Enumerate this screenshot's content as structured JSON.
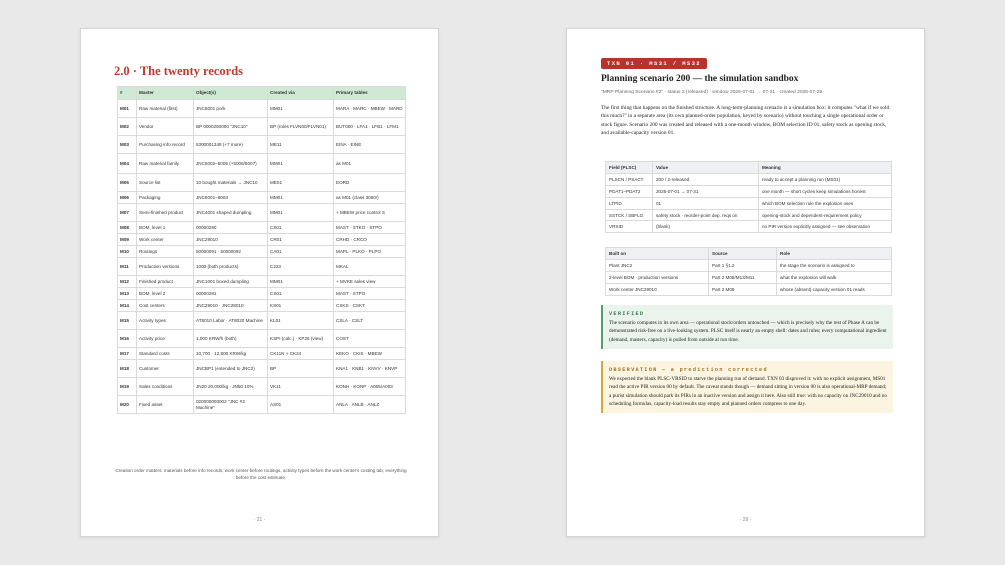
{
  "left_page": {
    "heading": "2.0 · The twenty records",
    "table": {
      "headers": [
        "#",
        "Master",
        "Object(s)",
        "Created via",
        "Primary tables"
      ],
      "rows": [
        [
          "M01",
          "Raw material (first)",
          "JNC5001 pork",
          "MM01",
          "MARA · MARC · MBEW · MARD"
        ],
        [
          "M02",
          "Vendor",
          "BP 0000260000 \"JNC10\"",
          "BP (roles FLVN00/FLVN01)",
          "BUT000 · LFA1 · LFB1 · LFM1"
        ],
        [
          "M03",
          "Purchasing info record",
          "5300001348 (+7 more)",
          "ME11",
          "EINA · EINE"
        ],
        [
          "M04",
          "Raw material family",
          "JNC5002–5005 (+5006/5007)",
          "MM01",
          "as M01"
        ],
        [
          "M05",
          "Source list",
          "10 bought materials → JNC10",
          "ME01",
          "EORD"
        ],
        [
          "M06",
          "Packaging",
          "JNC6001–6003",
          "MM01",
          "as M01 (class 3050!)"
        ],
        [
          "M07",
          "Semi-finished product",
          "JNC4001 shaped dumpling",
          "MM01",
          "+ MBEW price control S"
        ],
        [
          "M08",
          "BOM, level 1",
          "00000280",
          "CS01",
          "MAST · STKO · STPO"
        ],
        [
          "M09",
          "Work center",
          "JNC29010",
          "CR01",
          "CRHD · CRCO"
        ],
        [
          "M10",
          "Routings",
          "50000091 · 50000092",
          "CA01",
          "MAPL · PLKO · PLPO"
        ],
        [
          "M11",
          "Production versions",
          "1000 (both products)",
          "C223",
          "MKAL"
        ],
        [
          "M12",
          "Finished product",
          "JNC1001 boxed dumpling",
          "MM01",
          "+ MVKE sales view"
        ],
        [
          "M13",
          "BOM, level 2",
          "00000281",
          "CS01",
          "MAST · STPO"
        ],
        [
          "M14",
          "Cost centers",
          "JNC29010 · JNC28010",
          "KS01",
          "CSKS · CSKT"
        ],
        [
          "M15",
          "Activity types",
          "AT8010 Labor · AT8020 Machine",
          "KL01",
          "CSLA · CSLT"
        ],
        [
          "M16",
          "Activity price",
          "1,000 KRW/h (both)",
          "KSPI (calc.) · KP26 (view)",
          "COST"
        ],
        [
          "M17",
          "Standard costs",
          "10,700 · 12,800 KRW/kg",
          "CK11N + CK24",
          "KEKO · CKIS · MBEW"
        ],
        [
          "M18",
          "Customer",
          "JNCBP1 (extended to JNC2)",
          "BP",
          "KNA1 · KNB1 · KNVV · KNVP"
        ],
        [
          "M19",
          "Sales conditions",
          "JN20 20,000/kg · JN50 10%",
          "VK11",
          "KONH · KONP · A005/A003"
        ],
        [
          "M20",
          "Fixed asset",
          "020000000002 \"JNC #2 Machine\"",
          "AS01",
          "ANLA · ANLB · ANLZ"
        ]
      ]
    },
    "caption": "Creation order matters: materials before info records, work center before routings, activity types before the work center's costing tab, everything before the cost estimate.",
    "page_number": "· 21 ·"
  },
  "right_page": {
    "pill": "TXN 01 · MS31 / MS32",
    "heading": "Planning scenario 200 — the simulation sandbox",
    "meta": "\"MRP Planning Scenario #2\" · status 2 (released) · window 2026-07-01 → 07-31 · created 2026-07-29",
    "intro": "The first thing that happens on the finished structure. A long-term-planning scenario is a simulation box: it computes \"what if we sold this much?\" in a separate area (its own planned-order population, keyed by scenario) without touching a single operational order or stock figure. Scenario 200 was created and released with a one-month window, BOM selection ID 01, safety stock as opening stock, and available-capacity version 01.",
    "field_table": {
      "headers": [
        "Field (PLSC)",
        "Value",
        "Meaning"
      ],
      "rows": [
        [
          "PLSCN / PSACT",
          "200 / 2-released",
          "ready to accept a planning run (MS01)"
        ],
        [
          "PDAT1–PDAT2",
          "2026-07-01 → 07-31",
          "one month — short cycles keep simulations honest"
        ],
        [
          "LTPID",
          "01",
          "which BOM selection rule the explosion uses"
        ],
        [
          "SSTCK / SBFLG",
          "safety stock · reorder-point dep. reqs on",
          "opening-stock and dependent-requirement policy"
        ],
        [
          "VRSID",
          "(blank)",
          "no PIR version explicitly assigned — see observation"
        ]
      ]
    },
    "built_table": {
      "headers": [
        "Built on",
        "Source",
        "Role"
      ],
      "rows": [
        [
          "Plant JNC2",
          "Part 1 §1.2",
          "the stage the scenario is assigned to"
        ],
        [
          "2-level BOM · production versions",
          "Part 2 M08/M13/M11",
          "what the explosion will walk"
        ],
        [
          "Work center JNC29010",
          "Part 2 M09",
          "whose (absent) capacity version 01 reads"
        ]
      ]
    },
    "verified": {
      "title": "VERIFIED",
      "text": "The scenario computes in its own area — operational stock/orders untouched — which is precisely why the rest of Phase A can be demonstrated risk-free on a live-looking system. PLSC itself is nearly an empty shell: dates and rules; every computational ingredient (demand, masters, capacity) is pulled from outside at run time."
    },
    "observation": {
      "title": "OBSERVATION — a prediction corrected",
      "text": "We expected the blank PLSC-VRSID to starve the planning run of demand. TXN 03 disproved it: with no explicit assignment, MS01 read the active PIR version 00 by default. The caveat stands though — demand sitting in version 00 is also operational-MRP demand; a purist simulation should park its PIRs in an inactive version and assign it here. Also still true: with no capacity on JNC29010 and no scheduling formulas, capacity-load results stay empty and planned orders compress to one day."
    },
    "page_number": "· 29 ·"
  }
}
